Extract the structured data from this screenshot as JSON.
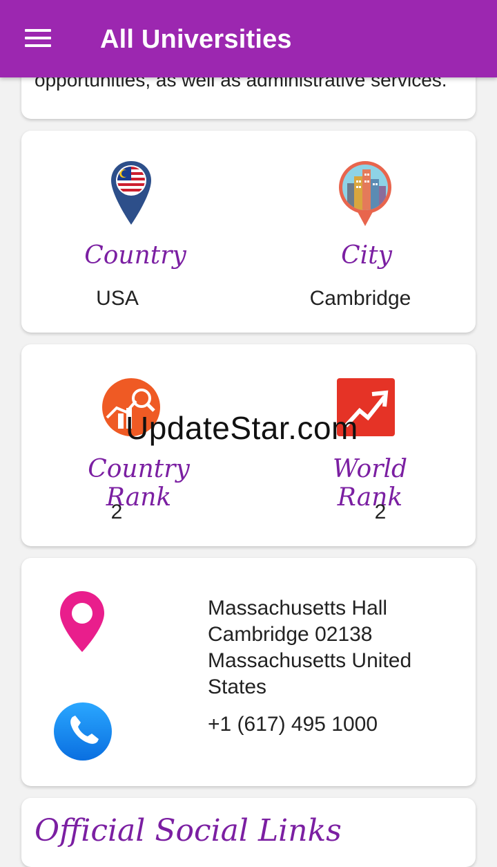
{
  "app_bar": {
    "title": "All Universities"
  },
  "description_card": {
    "text_tail": "opportunities, as well as administrative services."
  },
  "location_card": {
    "country": {
      "label": "Country",
      "value": "USA",
      "icon": "malaysia-flag-pin-icon"
    },
    "city": {
      "label": "City",
      "value": "Cambridge",
      "icon": "city-buildings-pin-icon"
    }
  },
  "rank_card": {
    "country_rank": {
      "label": "Country Rank",
      "value": "2",
      "icon": "rank-chart-icon"
    },
    "world_rank": {
      "label": "World Rank",
      "value": "2",
      "icon": "trend-up-icon"
    }
  },
  "watermark": "UpdateStar.com",
  "contact_card": {
    "address": " Massachusetts Hall Cambridge 02138 Massachusetts  United States",
    "phone": "+1 (617) 495 1000",
    "location_icon": "location-pin-icon",
    "phone_icon": "phone-icon"
  },
  "social_card": {
    "title": "Official Social Links"
  },
  "colors": {
    "primary": "#9c27b0",
    "script_text": "#7b1fa2",
    "pin_pink": "#e91e8c",
    "phone_blue": "#1e88e5"
  }
}
